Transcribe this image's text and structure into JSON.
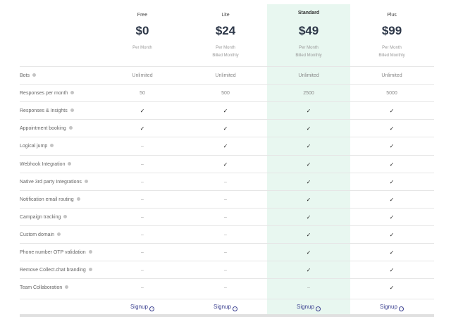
{
  "plans": [
    {
      "name": "Free",
      "price": "$0",
      "period": "Per Month",
      "billing": ""
    },
    {
      "name": "Lite",
      "price": "$24",
      "period": "Per Month",
      "billing": "Billed Monthly"
    },
    {
      "name": "Standard",
      "price": "$49",
      "period": "Per Month",
      "billing": "Billed Monthly"
    },
    {
      "name": "Plus",
      "price": "$99",
      "period": "Per Month",
      "billing": "Billed Monthly"
    }
  ],
  "highlight_color": "#e8f7f0",
  "check_symbol": "✓",
  "dash_symbol": "–",
  "features": [
    {
      "label": "Bots",
      "values": [
        "Unlimited",
        "Unlimited",
        "Unlimited",
        "Unlimited"
      ]
    },
    {
      "label": "Responses per month",
      "values": [
        "50",
        "500",
        "2500",
        "5000"
      ]
    },
    {
      "label": "Responses & Insights",
      "values": [
        "✓",
        "✓",
        "✓",
        "✓"
      ]
    },
    {
      "label": "Appointment booking",
      "values": [
        "✓",
        "✓",
        "✓",
        "✓"
      ]
    },
    {
      "label": "Logical jump",
      "values": [
        "–",
        "✓",
        "✓",
        "✓"
      ]
    },
    {
      "label": "Webhook Integration",
      "values": [
        "–",
        "✓",
        "✓",
        "✓"
      ]
    },
    {
      "label": "Native 3rd party Integrations",
      "values": [
        "–",
        "–",
        "✓",
        "✓"
      ]
    },
    {
      "label": "Notification email routing",
      "values": [
        "–",
        "–",
        "✓",
        "✓"
      ]
    },
    {
      "label": "Campaign tracking",
      "values": [
        "–",
        "–",
        "✓",
        "✓"
      ]
    },
    {
      "label": "Custom domain",
      "values": [
        "–",
        "–",
        "✓",
        "✓"
      ]
    },
    {
      "label": "Phone number OTP validation",
      "values": [
        "–",
        "–",
        "✓",
        "✓"
      ]
    },
    {
      "label": "Remove Collect.chat branding",
      "values": [
        "–",
        "–",
        "✓",
        "✓"
      ]
    },
    {
      "label": "Team Collaboration",
      "values": [
        "–",
        "–",
        "–",
        "✓"
      ]
    }
  ],
  "signup": {
    "label": "Signup",
    "icon": "arrow-circle-right-icon"
  }
}
